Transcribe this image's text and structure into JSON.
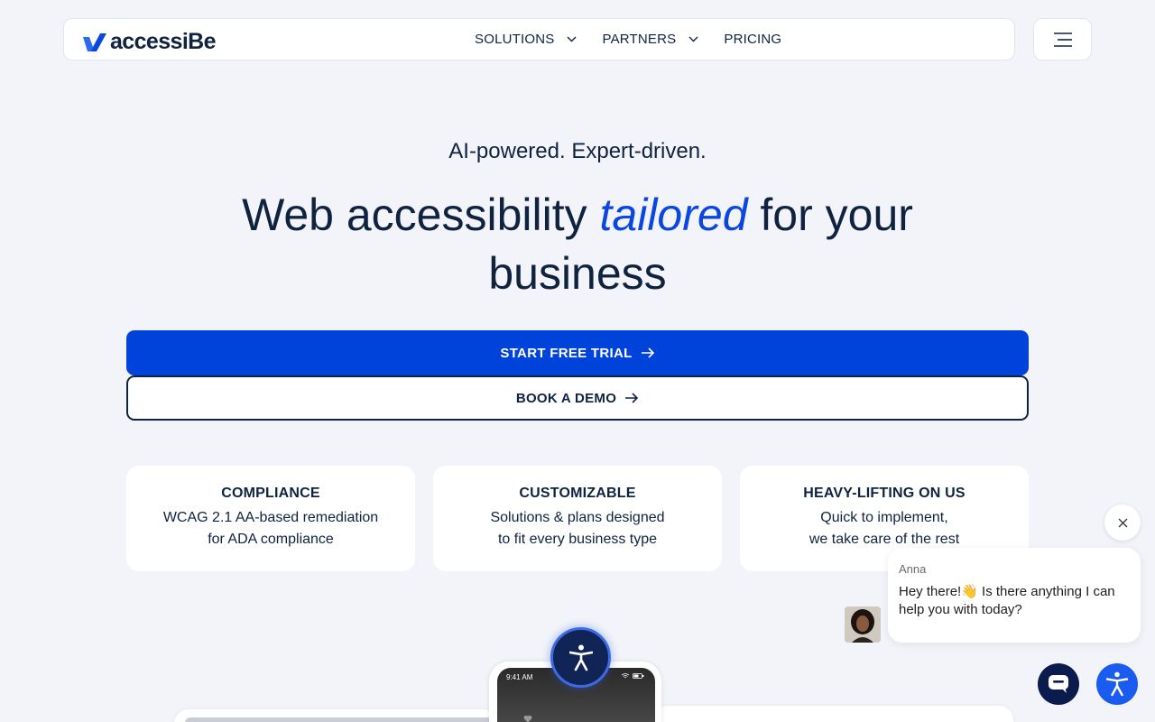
{
  "brand": {
    "name": "accessiBe",
    "accent": "#0043db",
    "dark": "#0f2340"
  },
  "nav": {
    "items": [
      {
        "label": "SOLUTIONS",
        "has_dropdown": true,
        "icon": "chevron-down-icon"
      },
      {
        "label": "PARTNERS",
        "has_dropdown": true,
        "icon": "chevron-down-icon"
      },
      {
        "label": "PRICING",
        "has_dropdown": false
      }
    ],
    "menu_icon": "hamburger-icon"
  },
  "hero": {
    "tagline": "AI-powered. Expert-driven.",
    "headline_before": "Web accessibility ",
    "headline_emphasis": "tailored",
    "headline_after": " for your business",
    "primary_cta": "START FREE TRIAL",
    "secondary_cta": "BOOK A DEMO"
  },
  "features": [
    {
      "title": "COMPLIANCE",
      "line1": "WCAG 2.1 AA-based remediation",
      "line2": "for ADA compliance"
    },
    {
      "title": "CUSTOMIZABLE",
      "line1": "Solutions & plans designed",
      "line2": "to fit every business type"
    },
    {
      "title": "HEAVY-LIFTING ON US",
      "line1": "Quick to implement,",
      "line2": "we take care of the rest"
    }
  ],
  "chat": {
    "agent_name": "Anna",
    "message": "Hey there!👋 Is there anything I can help you with today?"
  },
  "preview": {
    "phone_time": "9:41 AM"
  }
}
